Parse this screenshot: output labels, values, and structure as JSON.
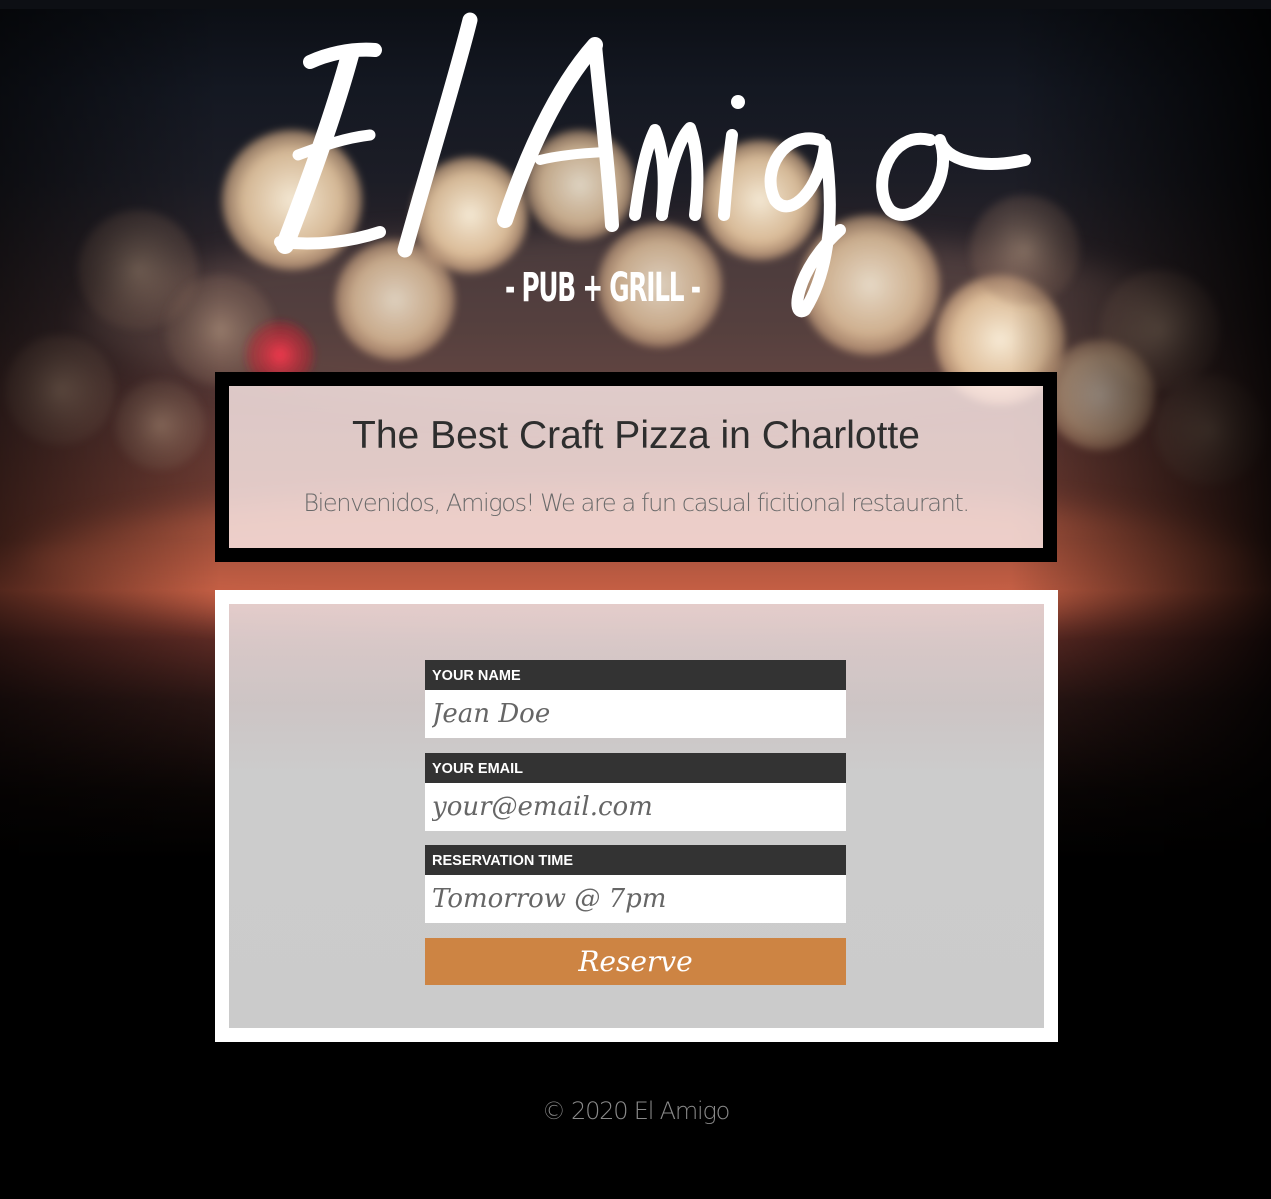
{
  "brand": {
    "name": "El Amigo",
    "tagline": "- PUB + GRILL -"
  },
  "hero": {
    "headline": "The Best Craft Pizza in Charlotte",
    "subheadline": "Bienvenidos, Amigos! We are a fun casual ficitional restaurant."
  },
  "form": {
    "name_label": "YOUR NAME",
    "name_placeholder": "Jean Doe",
    "email_label": "YOUR EMAIL",
    "email_placeholder": "your@email.com",
    "time_label": "RESERVATION TIME",
    "time_placeholder": "Tomorrow @ 7pm",
    "submit_label": "Reserve"
  },
  "footer": {
    "copyright": "© 2020 El Amigo"
  },
  "colors": {
    "accent": "#cd8443",
    "label_bg": "#333333",
    "form_bg": "#cccccc",
    "hero_border": "#000000",
    "card_border": "#ffffff"
  }
}
